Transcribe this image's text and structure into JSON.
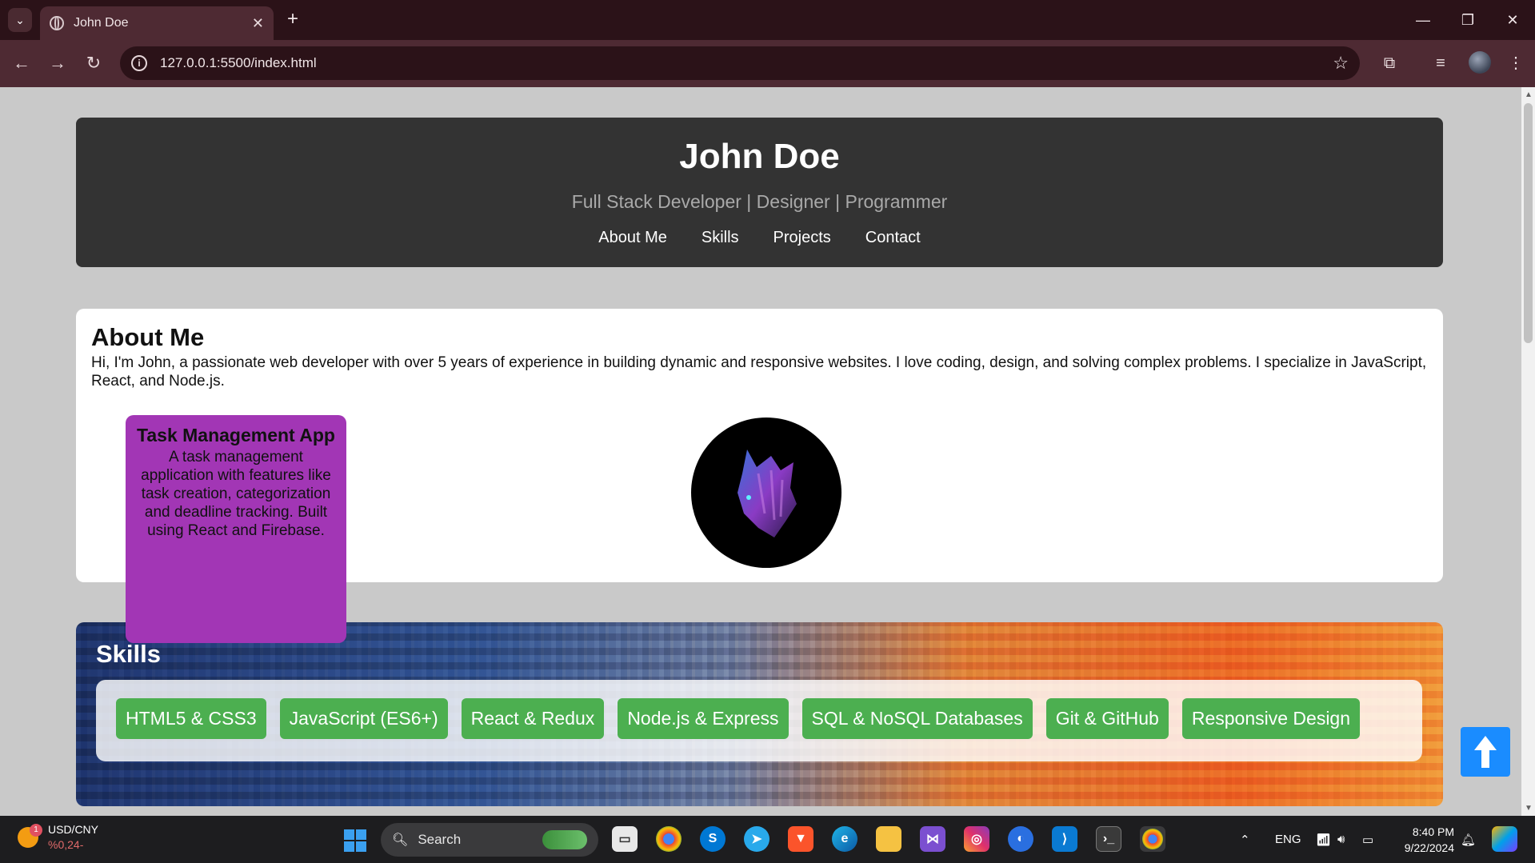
{
  "browser": {
    "tab_title": "John Doe",
    "tab_close": "✕",
    "new_tab": "+",
    "url": "127.0.0.1:5500/index.html",
    "win_minimize": "—",
    "win_restore": "❐",
    "win_close": "✕"
  },
  "header": {
    "name": "John Doe",
    "tagline": "Full Stack Developer | Designer | Programmer",
    "nav": [
      "About Me",
      "Skills",
      "Projects",
      "Contact"
    ]
  },
  "about": {
    "heading": "About Me",
    "text": "Hi, I'm John, a passionate web developer with over 5 years of experience in building dynamic and responsive websites. I love coding, design, and solving complex problems. I specialize in JavaScript, React, and Node.js."
  },
  "project_card": {
    "title": "Task Management App",
    "description": "A task management application with features like task creation, categorization and deadline tracking. Built using React and Firebase."
  },
  "skills": {
    "heading": "Skills",
    "items": [
      "HTML5 & CSS3",
      "JavaScript (ES6+)",
      "React & Redux",
      "Node.js & Express",
      "SQL & NoSQL Databases",
      "Git & GitHub",
      "Responsive Design"
    ]
  },
  "taskbar": {
    "widget_badge": "1",
    "widget_title": "USD/CNY",
    "widget_value": "%0,24-",
    "search_label": "Search",
    "language": "ENG",
    "time": "8:40 PM",
    "date": "9/22/2024"
  },
  "colors": {
    "header_bg": "#333333",
    "project_card": "#a236b5",
    "skill_chip": "#4caf50",
    "back_to_top": "#1a8cff"
  }
}
